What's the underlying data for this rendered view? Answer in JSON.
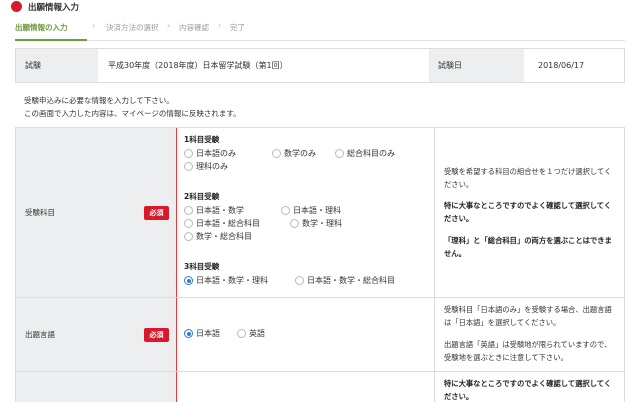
{
  "header": {
    "title": "出願情報入力"
  },
  "steps": [
    {
      "label": "出願情報の入力"
    },
    {
      "label": "決済方法の選択"
    },
    {
      "label": "内容確認"
    },
    {
      "label": "完了"
    }
  ],
  "exam_info": {
    "exam_label": "試験",
    "exam_value": "平成30年度（2018年度）日本留学試験（第1回）",
    "date_label": "試験日",
    "date_value": "2018/06/17"
  },
  "notes": [
    "受験申込みに必要な情報を入力して下さい。",
    "この画面で入力した内容は、マイページの情報に反映されます。"
  ],
  "subjects": {
    "label": "受験科目",
    "required": "必須",
    "group1_title": "1科目受験",
    "group1": [
      "日本語のみ",
      "数学のみ",
      "総合科目のみ",
      "理科のみ"
    ],
    "group2_title": "2科目受験",
    "group2": [
      "日本語・数学",
      "日本語・理科",
      "日本語・総合科目",
      "数学・理科",
      "数学・総合科目"
    ],
    "group3_title": "3科目受験",
    "group3": [
      "日本語・数学・理科",
      "日本語・数学・総合科目"
    ],
    "selected": "日本語・数学・理科",
    "help1": "受験を希望する科目の組合せを１つだけ選択してください。",
    "help2": "特に大事なところですのでよく確認して選択してください。",
    "help3": "「理科」と「総合科目」の両方を選ぶことはできません。"
  },
  "language": {
    "label": "出題言語",
    "required": "必須",
    "options": [
      "日本語",
      "英語"
    ],
    "selected": "日本語",
    "help1": "受験科目「日本語のみ」を受験する場合、出題言語は「日本語」を選択してください。",
    "help2": "出題言語「英語」は受験地が限られていますので、受験地を選ぶときに注意して下さい。"
  },
  "next_row": {
    "help1": "特に大事なところですのでよく確認して選択してください。"
  },
  "colors": {
    "accent_red": "#d7192b",
    "step_green": "#6f9d3a",
    "radio_blue": "#2f7ad6"
  }
}
